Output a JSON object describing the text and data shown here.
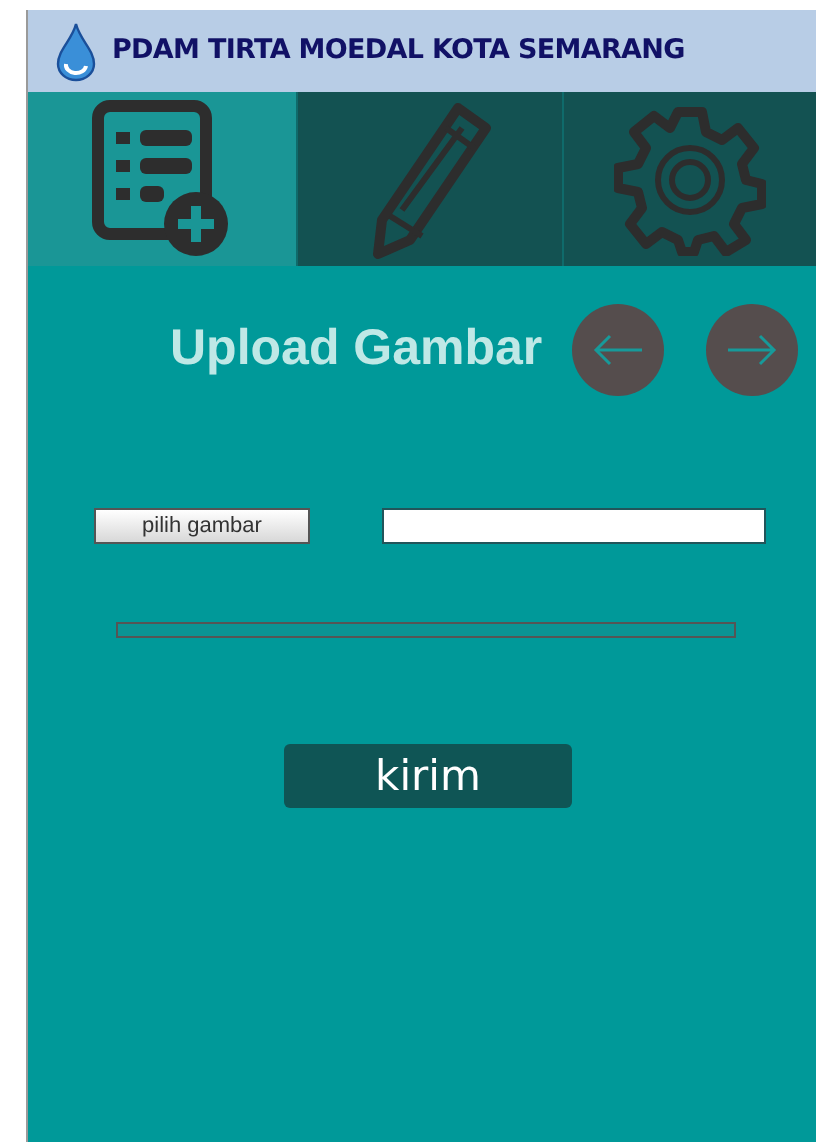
{
  "header": {
    "title": "PDAM TIRTA MOEDAL KOTA SEMARANG"
  },
  "tabs": [
    {
      "kind": "form",
      "selected": true
    },
    {
      "kind": "edit",
      "selected": false
    },
    {
      "kind": "settings",
      "selected": false
    }
  ],
  "upload": {
    "title": "Upload Gambar",
    "pick_button": "pilih gambar",
    "progress": {
      "level": 0
    },
    "submit_button": "kirim"
  }
}
